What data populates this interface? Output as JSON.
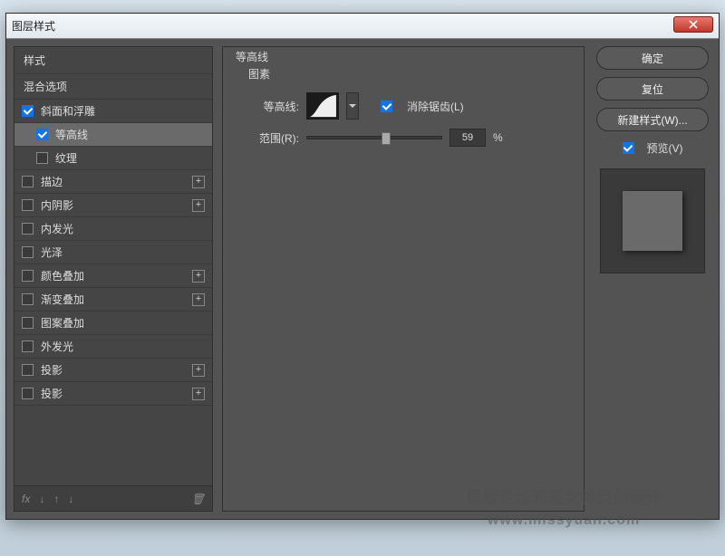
{
  "window": {
    "title": "图层样式"
  },
  "styles": {
    "header": "样式",
    "blend": "混合选项",
    "items": [
      {
        "label": "斜面和浮雕",
        "checked": true,
        "plus": false,
        "sub": false
      },
      {
        "label": "等高线",
        "checked": true,
        "plus": false,
        "sub": true,
        "selected": true
      },
      {
        "label": "纹理",
        "checked": false,
        "plus": false,
        "sub": true
      },
      {
        "label": "描边",
        "checked": false,
        "plus": true,
        "sub": false
      },
      {
        "label": "内阴影",
        "checked": false,
        "plus": true,
        "sub": false
      },
      {
        "label": "内发光",
        "checked": false,
        "plus": false,
        "sub": false
      },
      {
        "label": "光泽",
        "checked": false,
        "plus": false,
        "sub": false
      },
      {
        "label": "颜色叠加",
        "checked": false,
        "plus": true,
        "sub": false
      },
      {
        "label": "渐变叠加",
        "checked": false,
        "plus": true,
        "sub": false
      },
      {
        "label": "图案叠加",
        "checked": false,
        "plus": false,
        "sub": false
      },
      {
        "label": "外发光",
        "checked": false,
        "plus": false,
        "sub": false
      },
      {
        "label": "投影",
        "checked": false,
        "plus": true,
        "sub": false
      },
      {
        "label": "投影",
        "checked": false,
        "plus": true,
        "sub": false
      }
    ],
    "fx_label": "fx"
  },
  "panel": {
    "title": "等高线",
    "subtitle": "图素",
    "contour_label": "等高线:",
    "antialias_label": "消除锯齿(L)",
    "antialias_checked": true,
    "range_label": "范围(R):",
    "range_value": "59",
    "range_unit": "%"
  },
  "buttons": {
    "ok": "确定",
    "cancel": "复位",
    "new_style": "新建样式(W)...",
    "preview": "预览(V)",
    "preview_checked": true
  },
  "watermark": {
    "line1": "思缘论坛邪恶女神原创翻译",
    "line2": "www.missyuan.com"
  }
}
